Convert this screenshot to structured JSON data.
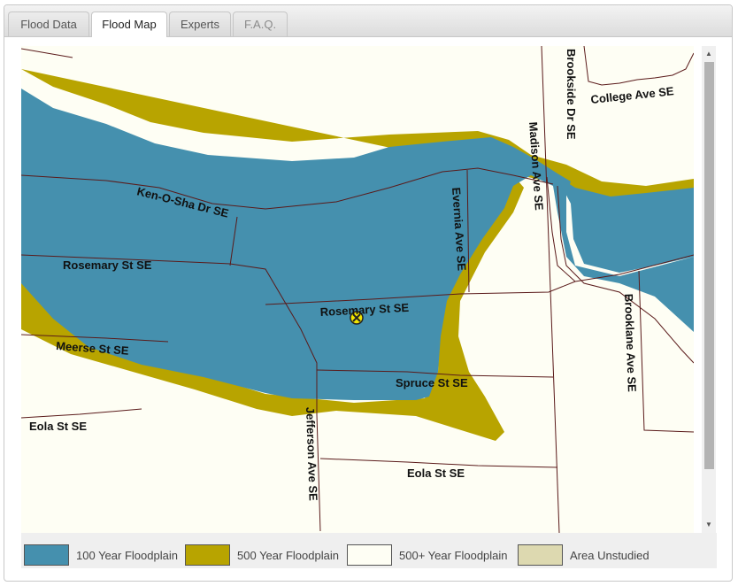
{
  "tabs": [
    {
      "label": "Flood Data"
    },
    {
      "label": "Flood Map"
    },
    {
      "label": "Experts"
    },
    {
      "label": "F.A.Q."
    }
  ],
  "map": {
    "streets": {
      "brookside_dr": "Brookside Dr SE",
      "college_ave": "College Ave SE",
      "madison_ave": "Madison Ave SE",
      "ken_o_sha_dr": "Ken-O-Sha Dr SE",
      "evernia_ave": "Evernia Ave SE",
      "rosemary_st_west": "Rosemary St SE",
      "rosemary_st_center": "Rosemary St SE",
      "brooklane_ave": "Brooklane Ave SE",
      "meerse_st": "Meerse St SE",
      "spruce_st": "Spruce St SE",
      "eola_st_west": "Eola St SE",
      "jefferson_ave": "Jefferson Ave SE",
      "eola_st_south": "Eola St SE"
    },
    "colors": {
      "floodplain_100": "#4590ae",
      "floodplain_500": "#b8a400",
      "floodplain_500_plus": "#fefef4",
      "area_unstudied": "#ddd9b0",
      "street_line": "#5a1a1a",
      "marker": "#f2e600"
    }
  },
  "legend": [
    {
      "label": "100 Year Floodplain",
      "color": "#4590ae"
    },
    {
      "label": "500 Year Floodplain",
      "color": "#b8a400"
    },
    {
      "label": "500+ Year Floodplain",
      "color": "#fefef4"
    },
    {
      "label": "Area Unstudied",
      "color": "#ddd9b0"
    }
  ]
}
